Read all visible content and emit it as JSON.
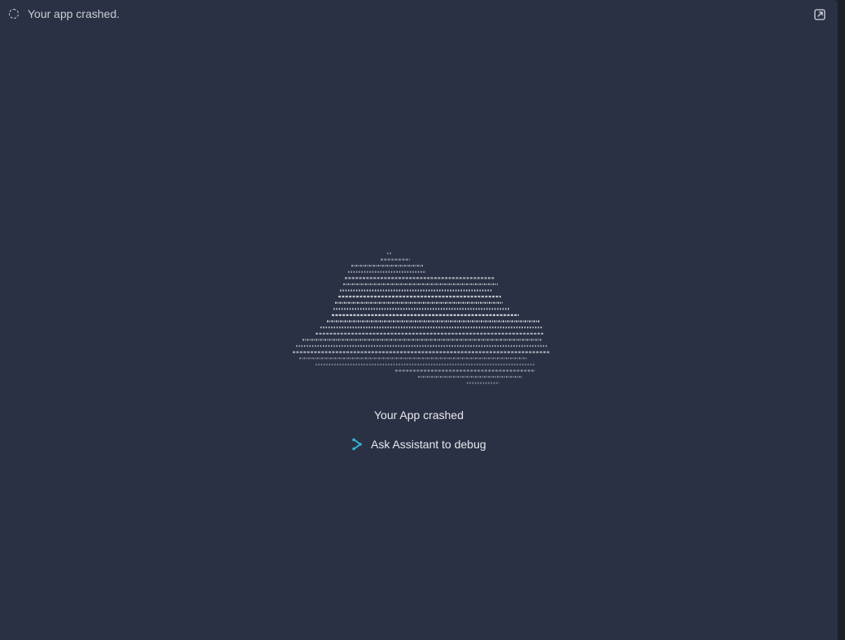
{
  "header": {
    "status_icon": "loading-spinner-icon",
    "title": "Your app crashed.",
    "open_icon": "open-in-new-icon"
  },
  "main": {
    "illustration": "ascii-art-cloud",
    "crash_title": "Your App crashed",
    "debug_link": {
      "icon": "assistant-icon",
      "label": "Ask Assistant to debug"
    }
  },
  "colors": {
    "panel_background": "#2b3144",
    "accent": "#35b4d8",
    "text": "#e8eaef"
  }
}
